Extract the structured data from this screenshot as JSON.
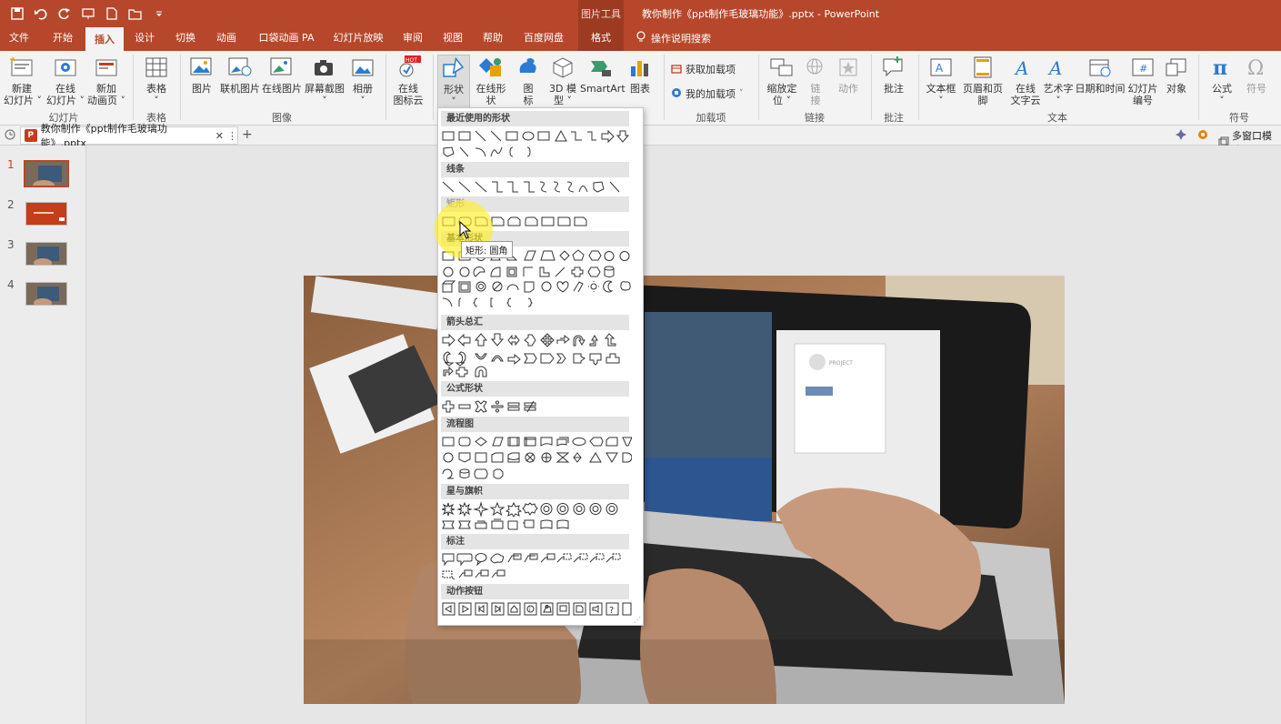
{
  "titlebar": {
    "context_tab": "图片工具",
    "document_title": "教你制作《ppt制作毛玻璃功能》.pptx  -  PowerPoint",
    "qat_icons": [
      "save-icon",
      "undo-icon",
      "redo-icon",
      "present-icon",
      "new-icon",
      "open-icon",
      "customize-icon"
    ]
  },
  "tabs": [
    "文件",
    "开始",
    "插入",
    "设计",
    "切换",
    "动画",
    "口袋动画 PA",
    "幻灯片放映",
    "审阅",
    "视图",
    "帮助",
    "百度网盘",
    "格式"
  ],
  "active_tab": "插入",
  "tell_me": "操作说明搜索",
  "ribbon": {
    "buttons": {
      "new_slide": "新建\n幻灯片 ˅",
      "online_slide": "在线\n幻灯片 ˅",
      "new_anim_page": "新加\n动画页 ˅",
      "table": "表格\n˅",
      "picture": "图片",
      "online_picture": "联机图片",
      "online_picture2": "在线图片",
      "screenshot": "屏幕截图\n˅",
      "album": "相册\n˅",
      "online_icon": "在线\n图标云",
      "shapes": "形状\n˅",
      "online_shapes": "在线形状",
      "icons": "图\n标",
      "model3d": "3D 模\n型 ˅",
      "smartart": "SmartArt",
      "chart": "图表",
      "get_addins": "获取加载项",
      "my_addins": "我的加载项",
      "zoom": "缩放定\n位 ˅",
      "link": "链\n接",
      "action": "动作",
      "comment": "批注",
      "textbox": "文本框\n˅",
      "header_footer": "页眉和页脚",
      "online_text_cloud": "在线\n文字云",
      "wordart": "艺术字\n˅",
      "datetime": "日期和时间",
      "slide_number": "幻灯片\n编号",
      "object": "对象",
      "equation": "公式\n˅",
      "symbol": "符号"
    },
    "groups": [
      "幻灯片",
      "表格",
      "图像",
      "加载项",
      "链接",
      "批注",
      "文本",
      "符号"
    ],
    "hot_badge": "HOT"
  },
  "docbar": {
    "tab_title": "教你制作《ppt制作毛玻璃功能》.pptx",
    "multiwindow": "多窗口模式"
  },
  "slides": [
    {
      "num": "1"
    },
    {
      "num": "2"
    },
    {
      "num": "3"
    },
    {
      "num": "4"
    }
  ],
  "shapes_menu": {
    "sections": [
      "最近使用的形状",
      "线条",
      "矩形",
      "基本形状",
      "箭头总汇",
      "公式形状",
      "流程图",
      "星与旗帜",
      "标注",
      "动作按钮"
    ],
    "tooltip": "矩形: 圆角"
  },
  "screen_text": {
    "project_label": "PROJECT"
  }
}
